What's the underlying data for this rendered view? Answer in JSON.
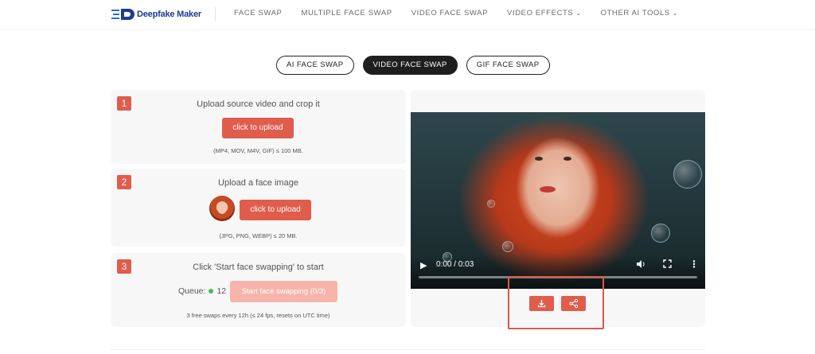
{
  "header": {
    "brand": "Deepfake Maker",
    "nav": [
      {
        "label": "FACE SWAP",
        "dropdown": false
      },
      {
        "label": "MULTIPLE FACE SWAP",
        "dropdown": false
      },
      {
        "label": "VIDEO FACE SWAP",
        "dropdown": false
      },
      {
        "label": "VIDEO EFFECTS",
        "dropdown": true
      },
      {
        "label": "OTHER AI TOOLS",
        "dropdown": true
      }
    ]
  },
  "tabs": [
    {
      "label": "AI FACE SWAP",
      "active": false
    },
    {
      "label": "VIDEO FACE SWAP",
      "active": true
    },
    {
      "label": "GIF FACE SWAP",
      "active": false
    }
  ],
  "steps": {
    "s1": {
      "num": "1",
      "title": "Upload source video and crop it",
      "button": "click to upload",
      "hint": "(MP4, MOV, M4V, GIF) ≤ 100 MB."
    },
    "s2": {
      "num": "2",
      "title": "Upload a face image",
      "button": "click to upload",
      "hint": "(JPG, PNG, WEBP) ≤ 20 MB."
    },
    "s3": {
      "num": "3",
      "title": "Click 'Start face swapping' to start",
      "queue_label": "Queue:",
      "queue_count": "12",
      "button": "Start face swapping (0/3)",
      "hint": "3 free swaps every 12h (≤ 24 fps, resets on UTC time)"
    }
  },
  "player": {
    "time": "0:00 / 0:03",
    "progress": 0
  },
  "colors": {
    "accent": "#e05c4b",
    "brand": "#1f3b8f",
    "status_ok": "#3fbf56"
  },
  "icons": {
    "download": "download-icon",
    "share": "share-icon"
  }
}
